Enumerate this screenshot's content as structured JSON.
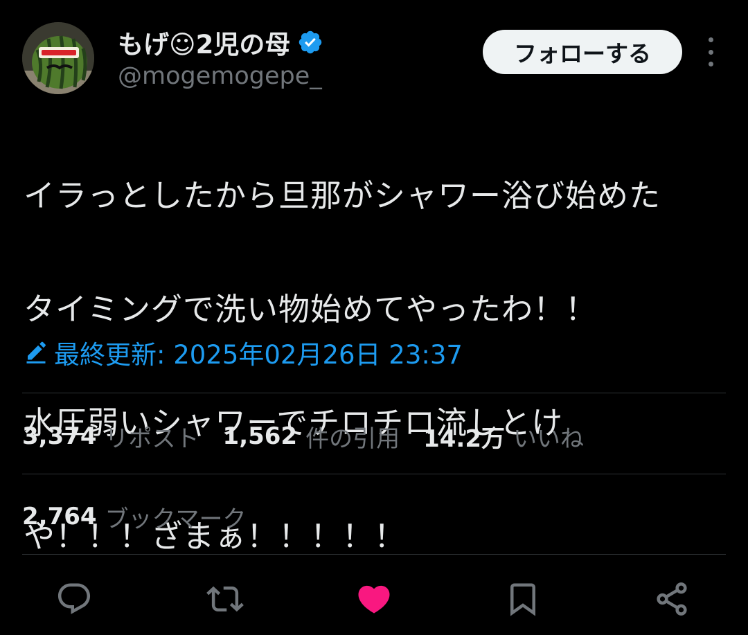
{
  "author": {
    "display_name": "もげ☺2児の母",
    "handle": "@mogemogepe_",
    "avatar_icon": "watermelon-avatar",
    "verified_icon": "verified-badge-icon",
    "verified_color": "#1d9bf0"
  },
  "header": {
    "follow_label": "フォローする",
    "more_icon": "more-dots-icon"
  },
  "tweet": {
    "text_lines": [
      "イラっとしたから旦那がシャワー浴び始めた",
      "タイミングで洗い物始めてやったわ！！",
      "水圧弱いシャワーでチロチロ流しとけ",
      "や！！！ざまぁ！！！！！"
    ],
    "edited_label": "最終更新: 2025年02月26日 23:37",
    "edited_icon": "pencil-icon"
  },
  "stats": {
    "reposts": {
      "count": "3,374",
      "label": "リポスト"
    },
    "quotes": {
      "count": "1,562",
      "label": "件の引用"
    },
    "likes": {
      "count": "14.2万",
      "label": "いいね"
    },
    "bookmarks": {
      "count": "2,764",
      "label": "ブックマーク"
    }
  },
  "actions": [
    {
      "name": "reply",
      "icon": "reply-icon"
    },
    {
      "name": "repost",
      "icon": "repost-icon"
    },
    {
      "name": "like",
      "icon": "heart-icon",
      "active": true,
      "color": "#f91880"
    },
    {
      "name": "bookmark",
      "icon": "bookmark-icon"
    },
    {
      "name": "share",
      "icon": "share-icon"
    }
  ],
  "colors": {
    "background": "#000000",
    "text_primary": "#e7e9ea",
    "text_secondary": "#71767b",
    "accent_blue": "#1d9bf0",
    "like_pink": "#f91880",
    "divider": "#2f3336"
  }
}
